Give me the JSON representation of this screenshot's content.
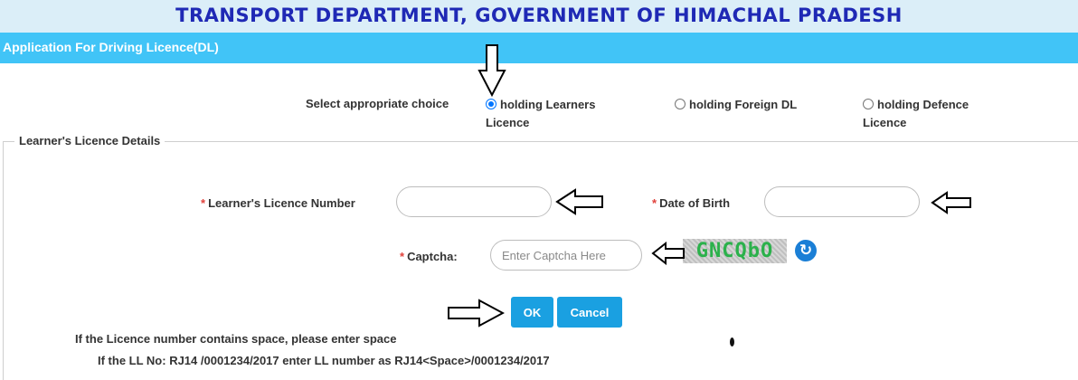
{
  "header": {
    "department_title": "TRANSPORT DEPARTMENT, GOVERNMENT OF HIMACHAL PRADESH",
    "app_title": "Application For Driving Licence(DL)"
  },
  "choice": {
    "label": "Select appropriate choice",
    "options": [
      {
        "line1": "holding Learners",
        "line2": "Licence",
        "checked": true
      },
      {
        "line1": "holding Foreign DL",
        "line2": "",
        "checked": false
      },
      {
        "line1": "holding Defence",
        "line2": "Licence",
        "checked": false
      }
    ]
  },
  "details": {
    "legend": "Learner's Licence Details",
    "required_marker": "*",
    "ll_number_label": "Learner's Licence Number",
    "ll_number_value": "",
    "dob_label": "Date of Birth",
    "dob_value": "",
    "captcha_label": "Captcha:",
    "captcha_placeholder": "Enter Captcha Here",
    "captcha_text": "GNCQbO"
  },
  "buttons": {
    "ok": "OK",
    "cancel": "Cancel"
  },
  "notes": {
    "line1": "If the Licence number contains space, please enter space",
    "line2": "If the LL No: RJ14 /0001234/2017 enter LL number as RJ14<Space>/0001234/2017"
  },
  "icons": {
    "refresh": "refresh-icon",
    "arrow": "arrow-icon"
  },
  "colors": {
    "header_bg": "#dbeef8",
    "header_text": "#1f29b5",
    "app_bar": "#41c4f7",
    "button": "#1aa0e1",
    "required": "#e0403a",
    "radio_checked": "#0075ff"
  }
}
